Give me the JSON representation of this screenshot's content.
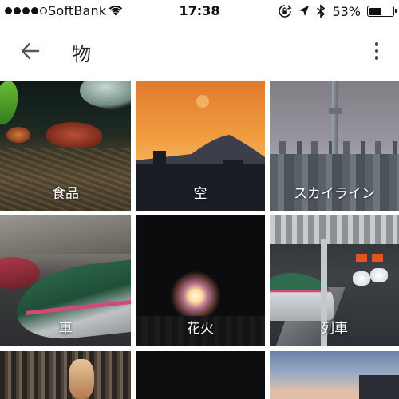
{
  "status_bar": {
    "carrier": "SoftBank",
    "time": "17:38",
    "battery_percent": "53%",
    "battery_level": 0.53,
    "icons": [
      "signal-dots-icon",
      "wifi-icon",
      "rotation-lock-icon",
      "location-arrow-icon",
      "bluetooth-icon",
      "battery-icon"
    ]
  },
  "app_bar": {
    "title": "物",
    "back_icon": "arrow-left-icon",
    "menu_icon": "more-vert-icon"
  },
  "grid": {
    "tiles": [
      {
        "label": "食品"
      },
      {
        "label": "空"
      },
      {
        "label": "スカイライン"
      },
      {
        "label": "車"
      },
      {
        "label": "花火"
      },
      {
        "label": "列車"
      },
      {
        "label": ""
      },
      {
        "label": ""
      },
      {
        "label": ""
      }
    ]
  }
}
